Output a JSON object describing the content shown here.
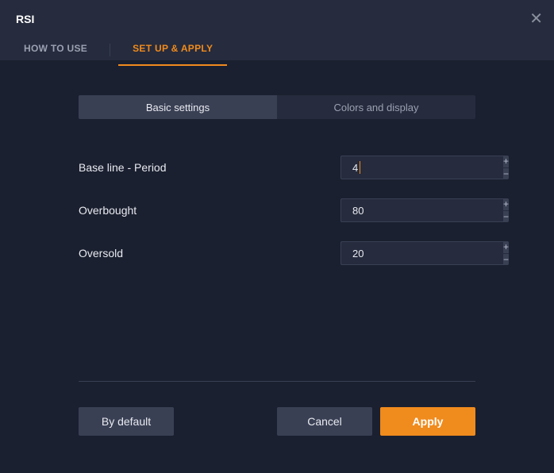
{
  "header": {
    "title": "RSI",
    "close_icon": "✕"
  },
  "tabs": {
    "howto": "HOW TO USE",
    "setup": "SET UP & APPLY"
  },
  "subtabs": {
    "basic": "Basic settings",
    "colors": "Colors and display"
  },
  "fields": {
    "baseline": {
      "label": "Base line - Period",
      "value": "4"
    },
    "overbought": {
      "label": "Overbought",
      "value": "80"
    },
    "oversold": {
      "label": "Oversold",
      "value": "20"
    }
  },
  "stepper": {
    "plus": "+",
    "minus": "−"
  },
  "buttons": {
    "default": "By default",
    "cancel": "Cancel",
    "apply": "Apply"
  }
}
